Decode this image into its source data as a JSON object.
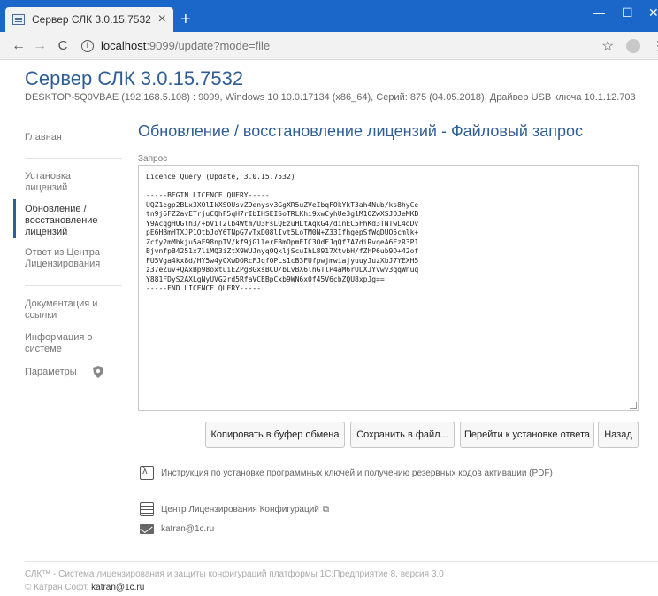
{
  "browser": {
    "tab_title": "Сервер СЛК 3.0.15.7532",
    "tab_close": "×",
    "new_tab": "+",
    "win_min": "—",
    "win_max": "☐",
    "win_close": "✕",
    "url_host": "localhost",
    "url_path": ":9099/update?mode=file",
    "back": "←",
    "forward": "→",
    "reload": "C",
    "info": "i",
    "star": "☆",
    "menu": "⋮"
  },
  "header": {
    "title": "Сервер СЛК 3.0.15.7532",
    "sysinfo": "DESKTOP-5Q0VBAE (192.168.5.108) : 9099,  Windows 10 10.0.17134 (x86_64),  Серий: 875 (04.05.2018),  Драйвер USB ключа 10.1.12.703"
  },
  "sidebar": {
    "items": [
      {
        "label": "Главная"
      },
      {
        "label": "Установка лицензий"
      },
      {
        "label": "Обновление / восстановление лицензий"
      },
      {
        "label": "Ответ из Центра Лицензирования"
      },
      {
        "label": "Документация и ссылки"
      },
      {
        "label": "Информация о системе"
      },
      {
        "label": "Параметры"
      }
    ]
  },
  "main": {
    "title": "Обновление / восстановление лицензий - Файловый запрос",
    "field_label": "Запрос",
    "query_text": "Licence Query (Update, 3.0.15.7532)\n\n-----BEGIN LICENCE QUERY-----\nUQZ1egp2BLx3XOlIkXSOUsvZ9enysv3GgXR5uZVeIbqFOkYkT3ah4Nub/ks8hyCe\ntn9j6FZ2avETrjuCQhF5qH7rIbIHSEISoTRLKhi9xwCyhUe3g1M1OZwXSJOJeMKB\nY9AcqgHUGlh3/+bViT2lb4Wtm/U3FsLQEzuHLtAqkG4/dinEC5FhKd3TNTwL4oDv\npE6HBmHTXJP1OtbJoY6TNpG7vTxD08lIvt5LoTM0N+Z33IfhgepSfWqDUO5cmlk+\nZcfy2mMhkju5aF98npTV/kf9jGllerFBmOpmFIC3OdFJqQf7A7diRvqeA6FzR3P1\nBjvnfpB4251x7liMQ3iZtX9WUJnyqOQkljScuIhL8917XtvbH/fZhP6ub9D+42of\nFU5Vga4kx8d/HY5w4yCXwDORcFJqfOPLs1cB3FUfpwjmwiajyuuyJuzXbJ7YEXH5\nz37eZuv+QAxBp98oxtuiEZPg8GxsBCU/bLvBX6lhGTlP4aM6rULXJYvwv3qqWnuq\nY881FDyS2AXLgNyUVG2rd5RfaVCEBpCxb9WN6x0f45V6cbZQU8xpJg==\n-----END LICENCE QUERY-----",
    "buttons": {
      "copy": "Копировать в буфер обмена",
      "save": "Сохранить в файл...",
      "goto_install": "Перейти к установке ответа",
      "back": "Назад"
    },
    "links": {
      "pdf": "Инструкция по установке программных ключей и получению резервных кодов активации (PDF)",
      "center": "Центр Лицензирования Конфигураций",
      "email": "katran@1c.ru",
      "ext_mark": "⧉"
    }
  },
  "footer": {
    "line1": "СЛК™ - Система лицензирования и защиты конфигураций платформы 1С:Предприятие 8, версия 3.0",
    "line2_prefix": "© Катран Софт, ",
    "line2_email": "katran@1c.ru"
  }
}
